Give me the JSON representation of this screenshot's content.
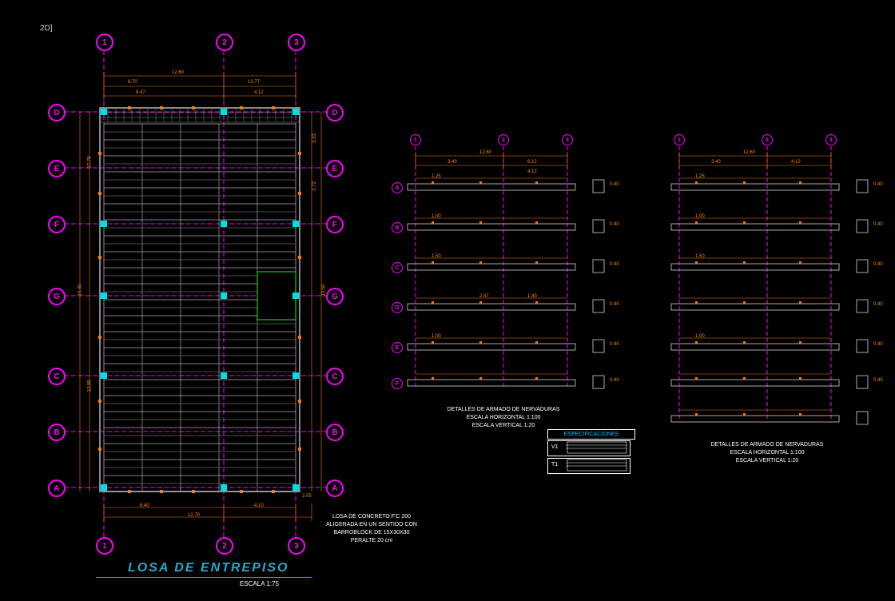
{
  "viewLabel": "2D]",
  "plan": {
    "title": "LOSA DE ENTREPISO",
    "scale": "ESCALA 1:75",
    "cols": [
      "1",
      "2",
      "3"
    ],
    "rows": [
      "D",
      "E",
      "F",
      "G",
      "C",
      "B",
      "A"
    ],
    "dimsTop": {
      "total": "12.60",
      "left": "8.70",
      "right": "13.77",
      "sub1": "8.47",
      "sub2": "4.12"
    },
    "dimsLeft": {
      "total": "14.40",
      "d1": "17.78",
      "d2": "12.09"
    },
    "dimsRight": {
      "total": "10.50",
      "d1": "3.33",
      "d2": "2.72"
    },
    "dimsBottom": {
      "d1": "8.40",
      "d2": "4.10",
      "total": "12.70",
      "ext": "2.05"
    },
    "note": "LOSA DE CONCRETO F'C 200\nALIGERADA EN UN SENTIDO CON\nBARROBLOCK DE 15X30X30\nPERALTE 20 cm"
  },
  "sections": {
    "titleA": "DETALLES DE ARMADO DE NERVADURAS",
    "scaleH": "ESCALA HORIZONTAL 1:100",
    "scaleV": "ESCALA VERTICAL 1:20",
    "cols": [
      "1",
      "2",
      "3"
    ],
    "rows": [
      "A",
      "B",
      "C",
      "D",
      "E",
      "F"
    ],
    "top": {
      "total": "12.60",
      "left": "3.40",
      "right": "6.12",
      "sub2": "4.12"
    },
    "rowDims": [
      "1.25",
      "1.00",
      "1.50",
      "2.47",
      "1.40",
      "1.00"
    ],
    "sideDims": [
      "0.40",
      "0.40",
      "0.40",
      "0.40",
      "0.40",
      "0.40"
    ]
  },
  "spec": {
    "header": "ESPECIFICACIONES",
    "v1": "V1",
    "t1": "T1"
  }
}
